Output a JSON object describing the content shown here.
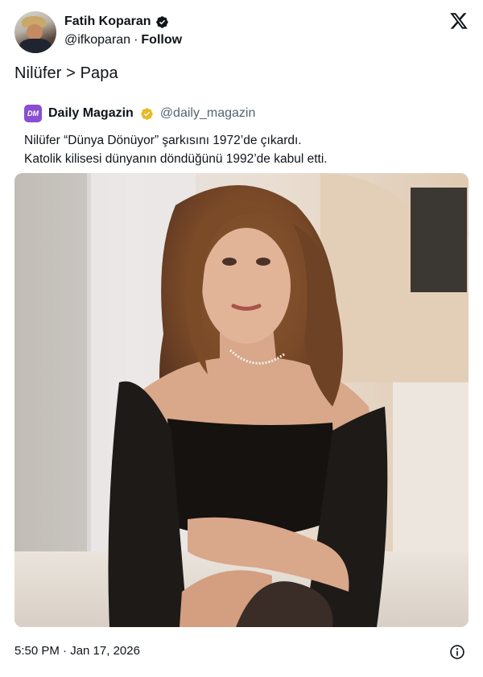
{
  "author": {
    "display_name": "Fatih Koparan",
    "handle": "@ifkoparan",
    "separator": "·",
    "follow_label": "Follow",
    "avatar_icon": "avatar-photo-icon",
    "verified_color": "#0f1419"
  },
  "tweet": {
    "text": "Nilüfer > Papa",
    "timestamp": "5:50 PM · Jan 17, 2026"
  },
  "quote": {
    "logo_text": "DM",
    "logo_color": "#8a4fd0",
    "display_name": "Daily Magazin",
    "handle": "@daily_magazin",
    "verified_color": "#e8b923",
    "line1": "Nilüfer “Dünya Dönüyor” şarkısını 1972’de çıkardı.",
    "line2": "Katolik kilisesi dünyanın döndüğünü 1992’de kabul etti."
  },
  "icons": {
    "brand": "x-logo-icon",
    "info": "info-icon"
  }
}
